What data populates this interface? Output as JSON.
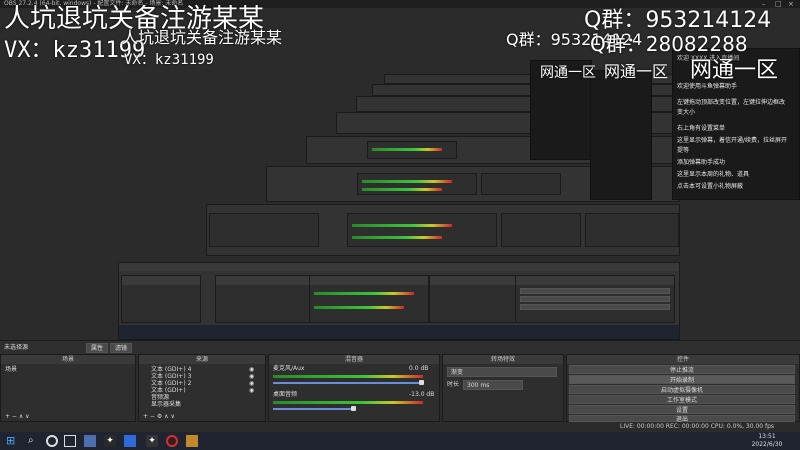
{
  "titlebar": {
    "text": "OBS 27.2.4 (64-bit, windows) - 配置文件: 未命名 - 场景: 未命名"
  },
  "overlay": {
    "top_left": "人坑退坑关备注游某某",
    "top_right": "Q群：953214124",
    "wx": "VX：kz31199",
    "mid_right": "Q群：28082288",
    "zone": "网通一区",
    "zone_small": "网通一区",
    "wx_repeat": "VX：kz31199"
  },
  "chat_panel": {
    "lines": [
      "欢迎 XXXX 进入直播间",
      "欢迎使用斗鱼弹幕助手",
      "左键拖动顶部改变位置，左键拉伸边框改",
      "变大小",
      "右上角有设置菜单",
      "这里显示弹幕，着信开通/续费，拉丝屏开",
      "提等",
      "添加弹幕助手成功",
      "这里显示本周的礼物、道具",
      "点击本可设置小礼物屏蔽"
    ]
  },
  "main": {
    "scene_header": "未选择源",
    "filter_btn": "属性",
    "filter_btn2": "滤镜",
    "docks": {
      "scenes": {
        "title": "场景",
        "items": [
          "场景"
        ]
      },
      "sources": {
        "title": "来源",
        "items": [
          "文本 (GDI+) 4",
          "文本 (GDI+) 3",
          "文本 (GDI+) 2",
          "文本 (GDI+)",
          "音频源",
          "显示器采集"
        ]
      },
      "mixer": {
        "title": "混音器",
        "ch1_label": "麦克风/Aux",
        "ch1_db": "0.0 dB",
        "ch2_label": "桌面音频",
        "ch2_db": "-13.0 dB"
      },
      "transitions": {
        "title": "转场特效",
        "type": "渐变",
        "duration_label": "时长",
        "duration": "300 ms"
      },
      "controls": {
        "title": "控件",
        "buttons": [
          "停止推流",
          "开始录制",
          "启动虚拟摄像机",
          "工作室模式",
          "设置",
          "退出"
        ]
      }
    },
    "status": "LIVE: 00:00:00   REC: 00:00:00   CPU: 0.0%, 30.00 fps"
  },
  "taskbar": {
    "time": "13:51",
    "date": "2022/6/30"
  }
}
